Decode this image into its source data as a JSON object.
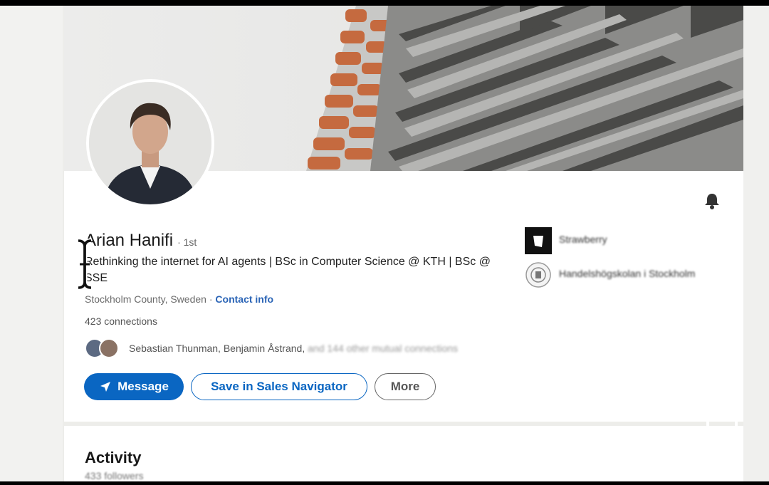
{
  "profile": {
    "name": "Arian Hanifi",
    "degree": "· 1st",
    "headline": "Rethinking the internet for AI agents | BSc in Computer Science @ KTH | BSc @ SSE",
    "location": "Stockholm County, Sweden",
    "separator": " · ",
    "contact_label": "Contact info",
    "connections": "423 connections",
    "mutual_names": "Sebastian Thunman, Benjamin Åstrand,",
    "mutual_rest": " and 144 other mutual connections"
  },
  "actions": {
    "message_label": "Message",
    "sales_nav_label": "Save in Sales Navigator",
    "more_label": "More"
  },
  "experience": [
    {
      "name": "Strawberry",
      "icon": "strawberry-logo"
    },
    {
      "name": "Handelshögskolan i Stockholm",
      "icon": "sse-logo"
    }
  ],
  "activity": {
    "title": "Activity",
    "followers": "433 followers"
  },
  "colors": {
    "accent": "#0a66c2",
    "link": "#2a64b6"
  },
  "icons": [
    "bell-icon",
    "send-icon",
    "text-cursor-icon",
    "fullscreen-icon"
  ]
}
